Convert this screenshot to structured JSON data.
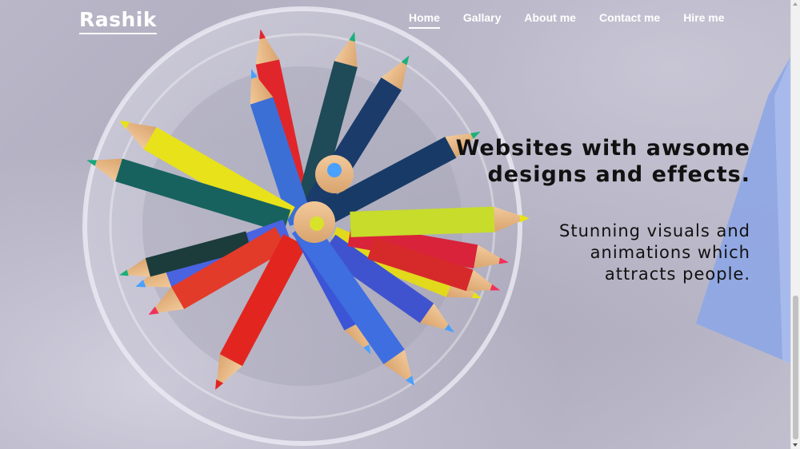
{
  "brand": {
    "name": "Rashik"
  },
  "nav": {
    "items": [
      {
        "label": "Home",
        "active": true
      },
      {
        "label": "Gallary",
        "active": false
      },
      {
        "label": "About me",
        "active": false
      },
      {
        "label": "Contact me",
        "active": false
      },
      {
        "label": "Hire me",
        "active": false
      }
    ]
  },
  "hero": {
    "headline_lines": [
      "Websites with awsome",
      "designs and effects."
    ],
    "subline_lines": [
      "Stunning visuals and",
      "animations which",
      "attracts people."
    ],
    "image_subject": "colored pencils in glass cup"
  },
  "colors": {
    "nav_text": "#ffffff",
    "hero_text": "#111111",
    "background": "#b7b5c6"
  }
}
